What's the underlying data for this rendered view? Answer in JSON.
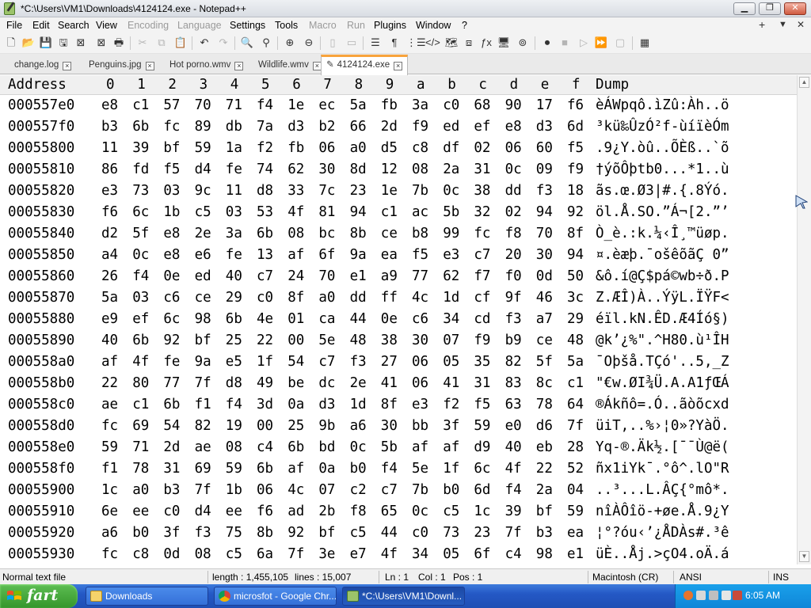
{
  "window": {
    "title": "*C:\\Users\\VM1\\Downloads\\4124124.exe - Notepad++",
    "minimize_glyph": "▁",
    "maximize_glyph": "❐",
    "close_glyph": "✕"
  },
  "menubar": {
    "items": [
      {
        "label": "File",
        "enabled": true
      },
      {
        "label": "Edit",
        "enabled": true
      },
      {
        "label": "Search",
        "enabled": true
      },
      {
        "label": "View",
        "enabled": true
      },
      {
        "label": "Encoding",
        "enabled": false
      },
      {
        "label": "Language",
        "enabled": false
      },
      {
        "label": "Settings",
        "enabled": true
      },
      {
        "label": "Tools",
        "enabled": true
      },
      {
        "label": "Macro",
        "enabled": false
      },
      {
        "label": "Run",
        "enabled": false
      },
      {
        "label": "Plugins",
        "enabled": true
      },
      {
        "label": "Window",
        "enabled": true
      },
      {
        "label": "?",
        "enabled": true
      }
    ],
    "right": [
      "+",
      "▼",
      "✕"
    ]
  },
  "toolbar": {
    "icons": [
      "new-file-icon",
      "open-file-icon",
      "save-icon",
      "save-all-icon",
      "close-icon",
      "close-all-icon",
      "print-icon",
      "cut-icon",
      "copy-icon",
      "paste-icon",
      "undo-icon",
      "redo-icon",
      "find-icon",
      "replace-icon",
      "zoom-in-icon",
      "zoom-out-icon",
      "sync-vertical-icon",
      "sync-horizontal-icon",
      "word-wrap-icon",
      "show-all-chars-icon",
      "indent-guide-icon",
      "xml-tag-icon",
      "doc-map-icon",
      "function-list-icon",
      "folder-workspace-icon",
      "monitor-icon",
      "record-macro-icon",
      "stop-macro-icon",
      "play-macro-icon",
      "run-macro-multiple-icon",
      "save-macro-icon",
      "plugin-icon"
    ]
  },
  "tabs": [
    {
      "label": "change.log",
      "active": false
    },
    {
      "label": "Penguins.jpg",
      "active": false
    },
    {
      "label": "Hot porno.wmv",
      "active": false
    },
    {
      "label": "Wildlife.wmv",
      "active": false
    },
    {
      "label": "4124124.exe",
      "active": true
    }
  ],
  "hex": {
    "header_address": "Address",
    "header_columns": [
      "0",
      "1",
      "2",
      "3",
      "4",
      "5",
      "6",
      "7",
      "8",
      "9",
      "a",
      "b",
      "c",
      "d",
      "e",
      "f"
    ],
    "header_dump": "Dump",
    "rows": [
      {
        "address": "000557e0",
        "bytes": [
          "e8",
          "c1",
          "57",
          "70",
          "71",
          "f4",
          "1e",
          "ec",
          "5a",
          "fb",
          "3a",
          "c0",
          "68",
          "90",
          "17",
          "f6"
        ],
        "dump": "èÁWpqô.ìZû:Àh..ö"
      },
      {
        "address": "000557f0",
        "bytes": [
          "b3",
          "6b",
          "fc",
          "89",
          "db",
          "7a",
          "d3",
          "b2",
          "66",
          "2d",
          "f9",
          "ed",
          "ef",
          "e8",
          "d3",
          "6d"
        ],
        "dump": "³kü‰ÛzÓ²f-ùíïèÓm"
      },
      {
        "address": "00055800",
        "bytes": [
          "11",
          "39",
          "bf",
          "59",
          "1a",
          "f2",
          "fb",
          "06",
          "a0",
          "d5",
          "c8",
          "df",
          "02",
          "06",
          "60",
          "f5"
        ],
        "dump": ".9¿Y.òû..ÕÈß..`õ"
      },
      {
        "address": "00055810",
        "bytes": [
          "86",
          "fd",
          "f5",
          "d4",
          "fe",
          "74",
          "62",
          "30",
          "8d",
          "12",
          "08",
          "2a",
          "31",
          "0c",
          "09",
          "f9"
        ],
        "dump": "†ýõÔþtb0...*1..ù"
      },
      {
        "address": "00055820",
        "bytes": [
          "e3",
          "73",
          "03",
          "9c",
          "11",
          "d8",
          "33",
          "7c",
          "23",
          "1e",
          "7b",
          "0c",
          "38",
          "dd",
          "f3",
          "18"
        ],
        "dump": "ãs.œ.Ø3|#.{.8Ýó."
      },
      {
        "address": "00055830",
        "bytes": [
          "f6",
          "6c",
          "1b",
          "c5",
          "03",
          "53",
          "4f",
          "81",
          "94",
          "c1",
          "ac",
          "5b",
          "32",
          "02",
          "94",
          "92"
        ],
        "dump": "öl.Å.SO.”Á¬[2.”’"
      },
      {
        "address": "00055840",
        "bytes": [
          "d2",
          "5f",
          "e8",
          "2e",
          "3a",
          "6b",
          "08",
          "bc",
          "8b",
          "ce",
          "b8",
          "99",
          "fc",
          "f8",
          "70",
          "8f"
        ],
        "dump": "Ò_è.:k.¼‹Î¸™üøp."
      },
      {
        "address": "00055850",
        "bytes": [
          "a4",
          "0c",
          "e8",
          "e6",
          "fe",
          "13",
          "af",
          "6f",
          "9a",
          "ea",
          "f5",
          "e3",
          "c7",
          "20",
          "30",
          "94"
        ],
        "dump": "¤.èæþ.¯ošêõãÇ 0”"
      },
      {
        "address": "00055860",
        "bytes": [
          "26",
          "f4",
          "0e",
          "ed",
          "40",
          "c7",
          "24",
          "70",
          "e1",
          "a9",
          "77",
          "62",
          "f7",
          "f0",
          "0d",
          "50"
        ],
        "dump": "&ô.í@Ç$pá©wb÷ð.P"
      },
      {
        "address": "00055870",
        "bytes": [
          "5a",
          "03",
          "c6",
          "ce",
          "29",
          "c0",
          "8f",
          "a0",
          "dd",
          "ff",
          "4c",
          "1d",
          "cf",
          "9f",
          "46",
          "3c"
        ],
        "dump": "Z.ÆÎ)À..ÝÿL.ÏŸF<"
      },
      {
        "address": "00055880",
        "bytes": [
          "e9",
          "ef",
          "6c",
          "98",
          "6b",
          "4e",
          "01",
          "ca",
          "44",
          "0e",
          "c6",
          "34",
          "cd",
          "f3",
          "a7",
          "29"
        ],
        "dump": "éïl.kN.ÊD.Æ4Íó§)"
      },
      {
        "address": "00055890",
        "bytes": [
          "40",
          "6b",
          "92",
          "bf",
          "25",
          "22",
          "00",
          "5e",
          "48",
          "38",
          "30",
          "07",
          "f9",
          "b9",
          "ce",
          "48"
        ],
        "dump": "@k’¿%\".^H80.ù¹ÎH"
      },
      {
        "address": "000558a0",
        "bytes": [
          "af",
          "4f",
          "fe",
          "9a",
          "e5",
          "1f",
          "54",
          "c7",
          "f3",
          "27",
          "06",
          "05",
          "35",
          "82",
          "5f",
          "5a"
        ],
        "dump": "¯Oþšå.TÇó'..5‚_Z"
      },
      {
        "address": "000558b0",
        "bytes": [
          "22",
          "80",
          "77",
          "7f",
          "d8",
          "49",
          "be",
          "dc",
          "2e",
          "41",
          "06",
          "41",
          "31",
          "83",
          "8c",
          "c1"
        ],
        "dump": "\"€w.ØI¾Ü.A.A1ƒŒÁ"
      },
      {
        "address": "000558c0",
        "bytes": [
          "ae",
          "c1",
          "6b",
          "f1",
          "f4",
          "3d",
          "0a",
          "d3",
          "1d",
          "8f",
          "e3",
          "f2",
          "f5",
          "63",
          "78",
          "64"
        ],
        "dump": "®Ákñô=.Ó..ãòõcxd"
      },
      {
        "address": "000558d0",
        "bytes": [
          "fc",
          "69",
          "54",
          "82",
          "19",
          "00",
          "25",
          "9b",
          "a6",
          "30",
          "bb",
          "3f",
          "59",
          "e0",
          "d6",
          "7f"
        ],
        "dump": "üiT‚..%›¦0»?YàÖ."
      },
      {
        "address": "000558e0",
        "bytes": [
          "59",
          "71",
          "2d",
          "ae",
          "08",
          "c4",
          "6b",
          "bd",
          "0c",
          "5b",
          "af",
          "af",
          "d9",
          "40",
          "eb",
          "28"
        ],
        "dump": "Yq-®.Äk½.[¯¯Ù@ë("
      },
      {
        "address": "000558f0",
        "bytes": [
          "f1",
          "78",
          "31",
          "69",
          "59",
          "6b",
          "af",
          "0a",
          "b0",
          "f4",
          "5e",
          "1f",
          "6c",
          "4f",
          "22",
          "52"
        ],
        "dump": "ñx1iYk¯.°ô^.lO\"R"
      },
      {
        "address": "00055900",
        "bytes": [
          "1c",
          "a0",
          "b3",
          "7f",
          "1b",
          "06",
          "4c",
          "07",
          "c2",
          "c7",
          "7b",
          "b0",
          "6d",
          "f4",
          "2a",
          "04"
        ],
        "dump": "..³...L.ÂÇ{°mô*."
      },
      {
        "address": "00055910",
        "bytes": [
          "6e",
          "ee",
          "c0",
          "d4",
          "ee",
          "f6",
          "ad",
          "2b",
          "f8",
          "65",
          "0c",
          "c5",
          "1c",
          "39",
          "bf",
          "59"
        ],
        "dump": "nîÀÔîö-+øe.Å.9¿Y"
      },
      {
        "address": "00055920",
        "bytes": [
          "a6",
          "b0",
          "3f",
          "f3",
          "75",
          "8b",
          "92",
          "bf",
          "c5",
          "44",
          "c0",
          "73",
          "23",
          "7f",
          "b3",
          "ea"
        ],
        "dump": "¦°?óu‹’¿ÅDÀs#.³ê"
      },
      {
        "address": "00055930",
        "bytes": [
          "fc",
          "c8",
          "0d",
          "08",
          "c5",
          "6a",
          "7f",
          "3e",
          "e7",
          "4f",
          "34",
          "05",
          "6f",
          "c4",
          "98",
          "e1"
        ],
        "dump": "üÈ..Åj.>çO4.oÄ.á"
      }
    ]
  },
  "statusbar": {
    "file_type": "Normal text file",
    "length": "length : 1,455,105",
    "lines": "lines : 15,007",
    "ln": "Ln : 1",
    "col": "Col : 1",
    "pos": "Pos : 1",
    "eol": "Macintosh (CR)",
    "encoding": "ANSI",
    "mode": "INS"
  },
  "taskbar": {
    "start_label": "fart",
    "tasks": [
      {
        "label": "Downloads",
        "icon": "folder-icon",
        "active": false
      },
      {
        "label": "microsfot - Google Chr...",
        "icon": "chrome-icon",
        "active": false
      },
      {
        "label": "*C:\\Users\\VM1\\Downl...",
        "icon": "notepadpp-icon",
        "active": true
      }
    ],
    "clock": "6:05 AM"
  },
  "colors": {
    "active_tab_accent": "#f8a33c",
    "taskbar_blue": "#2458c5",
    "start_green": "#34962b",
    "tray_blue": "#0f86d8"
  }
}
